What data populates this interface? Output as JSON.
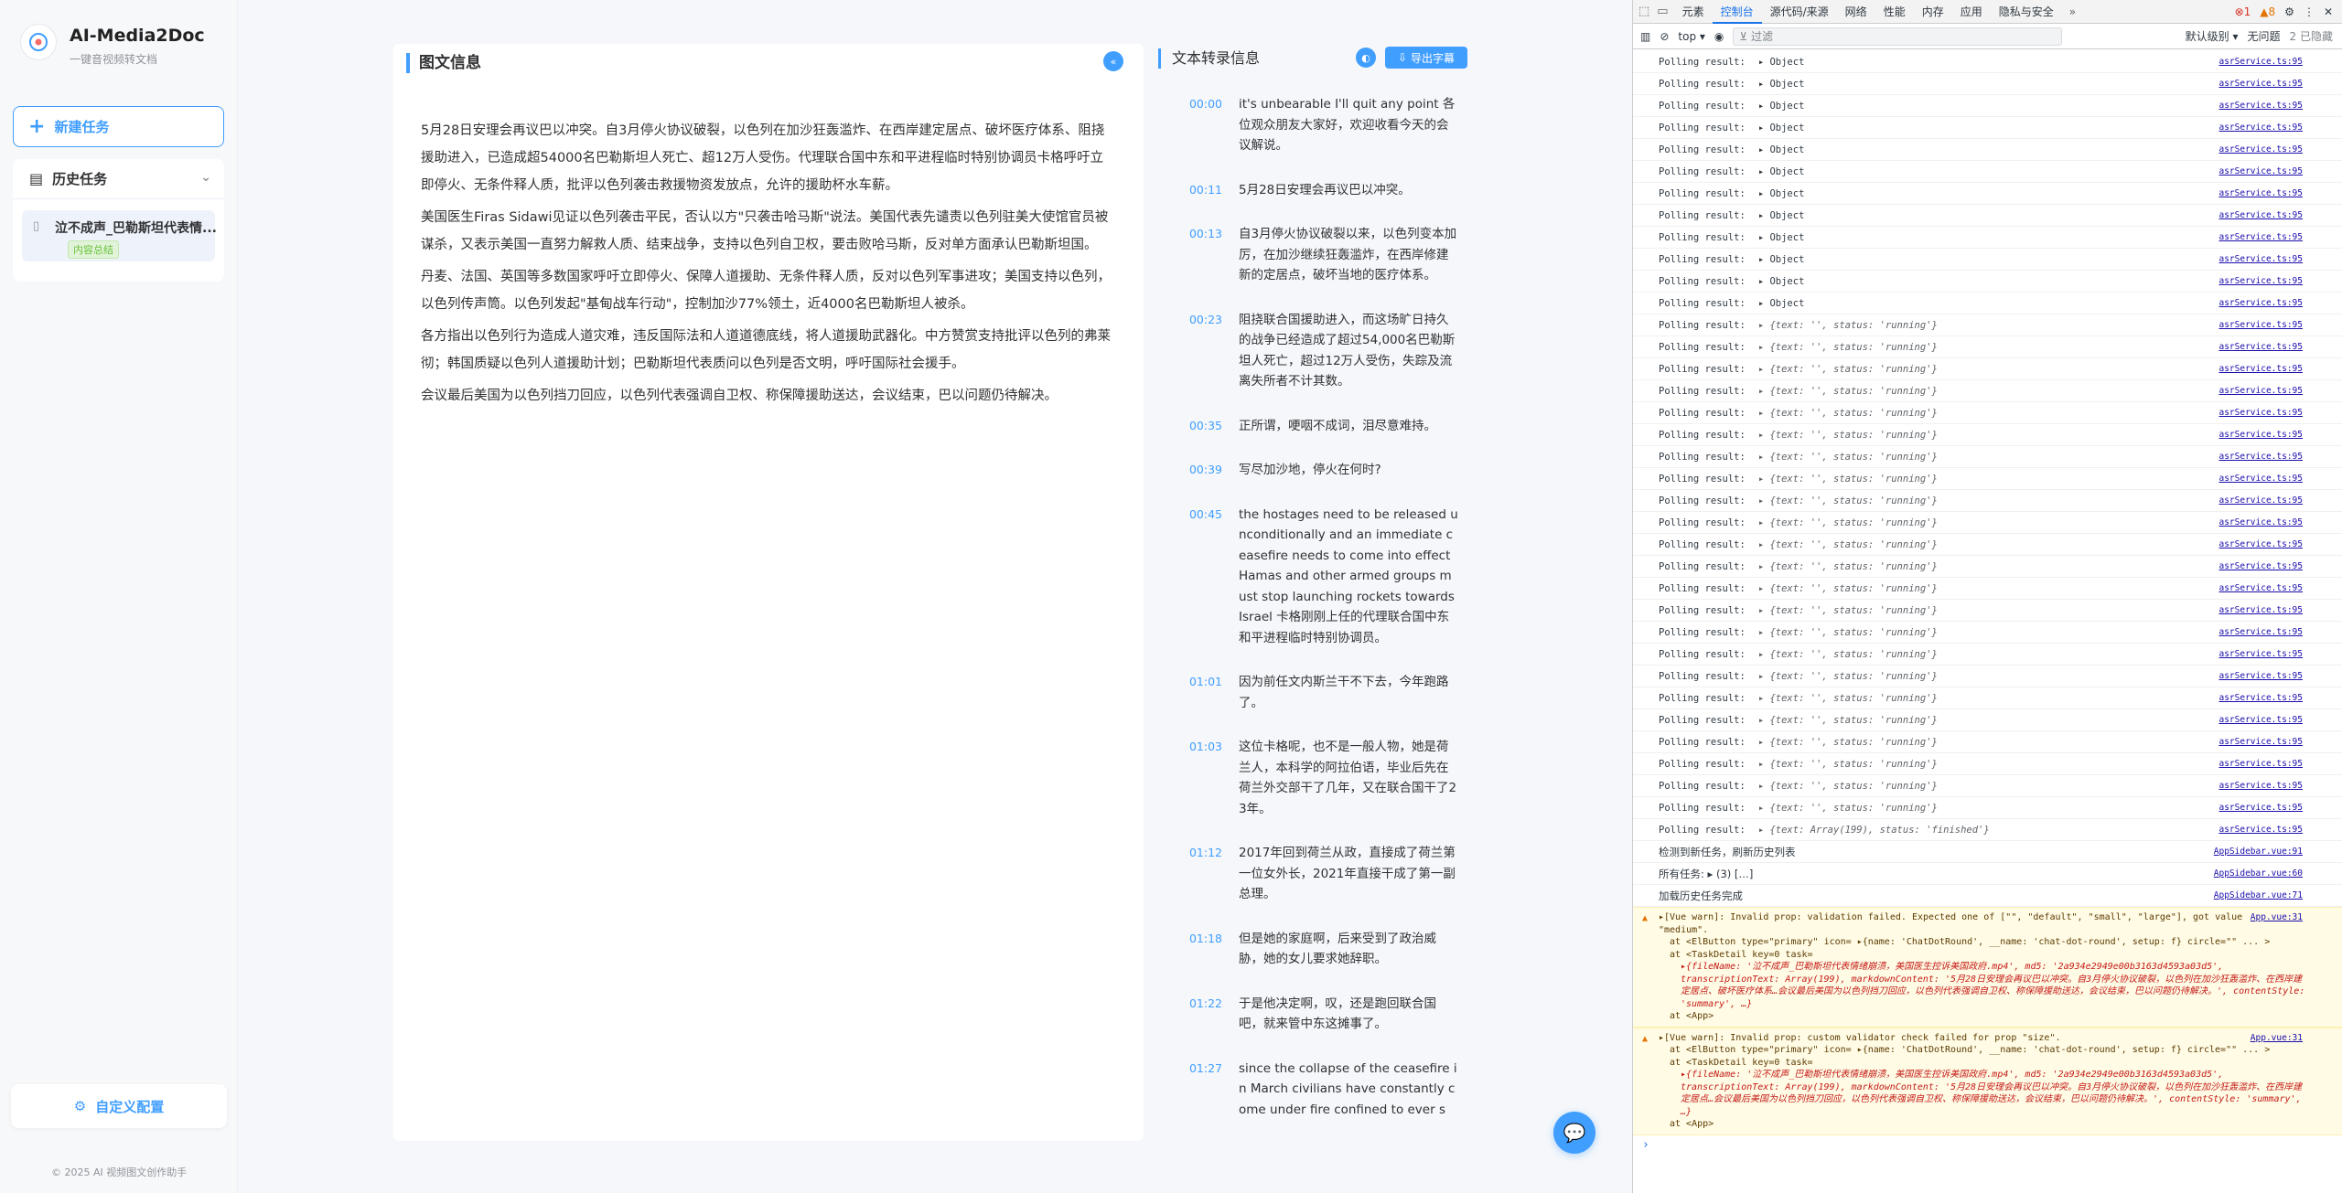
{
  "app": {
    "brand": "AI-Media2Doc",
    "subtitle": "一键音视频转文档",
    "new_task": "新建任务",
    "history_title": "历史任务",
    "history_items": [
      {
        "name": "泣不成声_巴勒斯坦代表情...",
        "tag": "内容总结"
      }
    ],
    "config_btn": "自定义配置",
    "copyright": "© 2025 AI 视频图文创作助手"
  },
  "article_card": {
    "title": "图文信息",
    "paragraphs": [
      "5月28日安理会再议巴以冲突。自3月停火协议破裂，以色列在加沙狂轰滥炸、在西岸建定居点、破坏医疗体系、阻挠援助进入，已造成超54000名巴勒斯坦人死亡、超12万人受伤。代理联合国中东和平进程临时特别协调员卡格呼吁立即停火、无条件释人质，批评以色列袭击救援物资发放点，允许的援助杯水车薪。",
      "美国医生Firas Sidawi见证以色列袭击平民，否认以方\"只袭击哈马斯\"说法。美国代表先谴责以色列驻美大使馆官员被谋杀，又表示美国一直努力解救人质、结束战争，支持以色列自卫权，要击败哈马斯，反对单方面承认巴勒斯坦国。",
      "丹麦、法国、英国等多数国家呼吁立即停火、保障人道援助、无条件释人质，反对以色列军事进攻；美国支持以色列，以色列传声筒。以色列发起\"基甸战车行动\"，控制加沙77%领土，近4000名巴勒斯坦人被杀。",
      "各方指出以色列行为造成人道灾难，违反国际法和人道道德底线，将人道援助武器化。中方赞赏支持批评以色列的弗莱彻；韩国质疑以色列人道援助计划；巴勒斯坦代表质问以色列是否文明，呼吁国际社会援手。",
      "会议最后美国为以色列挡刀回应，以色列代表强调自卫权、称保障援助送达，会议结束，巴以问题仍待解决。"
    ]
  },
  "transcript": {
    "title": "文本转录信息",
    "export_label": "导出字幕",
    "segments": [
      {
        "time": "00:00",
        "text": "it's unbearable I'll quit any point 各位观众朋友大家好，欢迎收看今天的会议解说。"
      },
      {
        "time": "00:11",
        "text": "5月28日安理会再议巴以冲突。"
      },
      {
        "time": "00:13",
        "text": "自3月停火协议破裂以来，以色列变本加厉，在加沙继续狂轰滥炸，在西岸修建新的定居点，破坏当地的医疗体系。"
      },
      {
        "time": "00:23",
        "text": "阻挠联合国援助进入，而这场旷日持久的战争已经造成了超过54,000名巴勒斯坦人死亡，超过12万人受伤，失踪及流离失所者不计其数。"
      },
      {
        "time": "00:35",
        "text": "正所谓，哽咽不成词，泪尽意难持。"
      },
      {
        "time": "00:39",
        "text": "写尽加沙地，停火在何时?"
      },
      {
        "time": "00:45",
        "text": "the hostages need to be released unconditionally and an immediate ceasefire needs to come into effect Hamas and other armed groups must stop launching rockets towards Israel 卡格刚刚上任的代理联合国中东和平进程临时特别协调员。"
      },
      {
        "time": "01:01",
        "text": "因为前任文内斯兰干不下去，今年跑路了。"
      },
      {
        "time": "01:03",
        "text": "这位卡格呢，也不是一般人物，她是荷兰人，本科学的阿拉伯语，毕业后先在荷兰外交部干了几年，又在联合国干了23年。"
      },
      {
        "time": "01:12",
        "text": "2017年回到荷兰从政，直接成了荷兰第一位女外长，2021年直接干成了第一副总理。"
      },
      {
        "time": "01:18",
        "text": "但是她的家庭啊，后来受到了政治威胁，她的女儿要求她辞职。"
      },
      {
        "time": "01:22",
        "text": "于是他决定啊，叹，还是跑回联合国吧，就来管中东这摊事了。"
      },
      {
        "time": "01:27",
        "text": "since the collapse of the ceasefire in March civilians have constantly come under fire confined to ever s"
      }
    ]
  },
  "devtools": {
    "tabs": [
      "元素",
      "控制台",
      "源代码/来源",
      "网络",
      "性能",
      "内存",
      "应用",
      "隐私与安全"
    ],
    "active_tab": "控制台",
    "errors": "1",
    "warnings": "8",
    "context": "top",
    "filter_placeholder": "过滤",
    "level": "默认级别",
    "no_issues": "无问题",
    "hidden": "2 已隐藏",
    "poll_label": "Polling result:",
    "poll_src": "asrService.ts:95",
    "object_text": "▸ Object",
    "running_text": "▸ {text: '', status: 'running'}",
    "finished_text": "▸ {text: Array(199), status: 'finished'}",
    "object_count": "12",
    "running_count": "23",
    "extra_lines": [
      {
        "msg": "检测到新任务，刷新历史列表",
        "src": "AppSidebar.vue:91"
      },
      {
        "msg": "所有任务: ▸ (3) […]",
        "src": "AppSidebar.vue:60"
      },
      {
        "msg": "加载历史任务完成",
        "src": "AppSidebar.vue:71"
      }
    ],
    "warn1": {
      "head": "▸[Vue warn]: Invalid prop: validation failed. Expected one of [\"\", \"default\", \"small\", \"large\"], got value \"medium\".",
      "src": "App.vue:31",
      "l2": "at <ElButton type=\"primary\" icon= ▸{name: 'ChatDotRound', __name: 'chat-dot-round', setup: f} circle=\"\" ... >",
      "l3": "at <TaskDetail key=0 task=",
      "l4": "▸{fileName: '泣不成声_巴勒斯坦代表情绪崩溃，美国医生控诉美国政府.mp4', md5: '2a934e2949e00b3163d4593a03d5', transcriptionText: Array(199), markdownContent: '5月28日安理会再议巴以冲突。自3月停火协议破裂，以色列在加沙狂轰滥炸、在西岸建定居点、破坏医疗体系…会议最后美国为以色列挡刀回应，以色列代表强调自卫权、称保障援助送达，会议结束，巴以问题仍待解决。', contentStyle: 'summary', …}",
      "l5": "at <App>"
    },
    "warn2": {
      "head": "▸[Vue warn]: Invalid prop: custom validator check failed for prop \"size\".",
      "src": "App.vue:31",
      "l2": "at <ElButton type=\"primary\" icon= ▸{name: 'ChatDotRound', __name: 'chat-dot-round', setup: f} circle=\"\" ... >",
      "l3": "at <TaskDetail key=0 task=",
      "l4": "▸{fileName: '泣不成声_巴勒斯坦代表情绪崩溃，美国医生控诉美国政府.mp4', md5: '2a934e2949e00b3163d4593a03d5', transcriptionText: Array(199), markdownContent: '5月28日安理会再议巴以冲突。自3月停火协议破裂，以色列在加沙狂轰滥炸、在西岸建定居点…会议最后美国为以色列挡刀回应，以色列代表强调自卫权、称保障援助送达，会议结束，巴以问题仍待解决。', contentStyle: 'summary', …}",
      "l5": "at <App>"
    },
    "prompt": "›"
  }
}
